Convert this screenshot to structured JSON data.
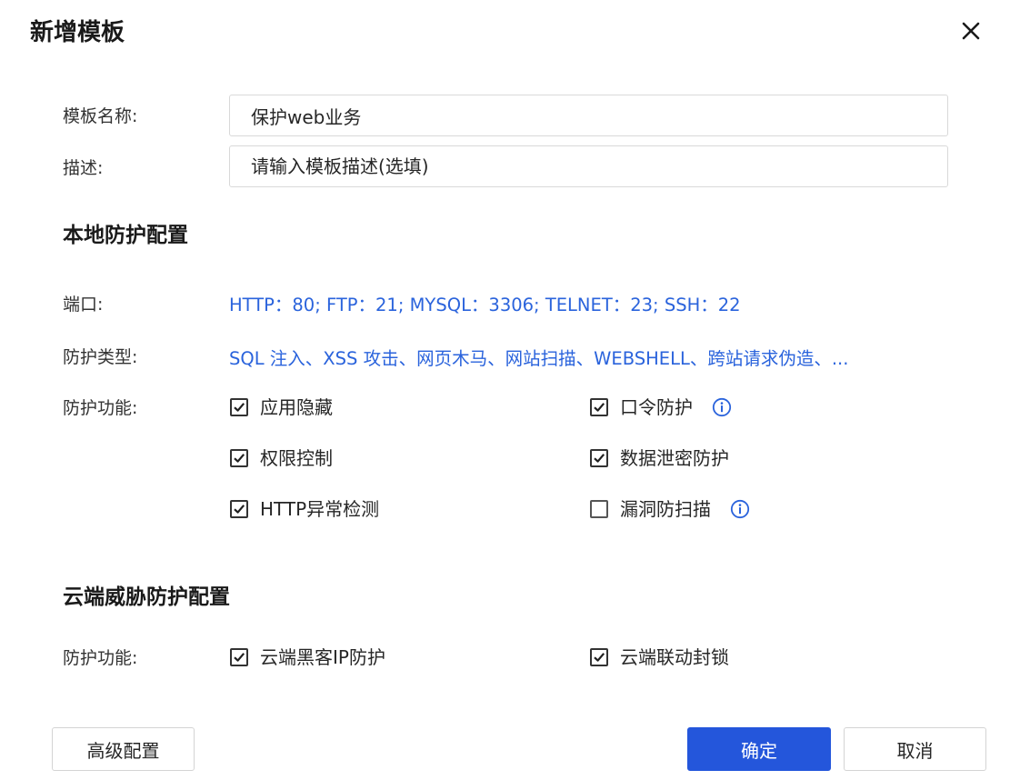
{
  "dialog": {
    "title": "新增模板",
    "close_icon": "close-icon"
  },
  "form": {
    "name_label": "模板名称:",
    "name_value": "保护web业务",
    "desc_label": "描述:",
    "desc_placeholder": "请输入模板描述(选填)"
  },
  "local": {
    "section_title": "本地防护配置",
    "ports_label": "端口:",
    "ports_value": "HTTP：80; FTP：21; MYSQL：3306; TELNET：23; SSH：22",
    "types_label": "防护类型:",
    "types_value": "SQL 注入、XSS 攻击、网页木马、网站扫描、WEBSHELL、跨站请求伪造、...",
    "functions_label": "防护功能:",
    "functions": [
      {
        "label": "应用隐藏",
        "checked": true
      },
      {
        "label": "口令防护",
        "checked": true,
        "info": true
      },
      {
        "label": "权限控制",
        "checked": true
      },
      {
        "label": "数据泄密防护",
        "checked": true
      },
      {
        "label": "HTTP异常检测",
        "checked": true
      },
      {
        "label": "漏洞防扫描",
        "checked": false,
        "info": true
      }
    ]
  },
  "cloud": {
    "section_title": "云端威胁防护配置",
    "functions_label": "防护功能:",
    "functions": [
      {
        "label": "云端黑客IP防护",
        "checked": true
      },
      {
        "label": "云端联动封锁",
        "checked": true
      }
    ]
  },
  "footer": {
    "advanced_label": "高级配置",
    "confirm_label": "确定",
    "cancel_label": "取消"
  },
  "colors": {
    "primary": "#2456db",
    "link": "#2a63dc",
    "info_icon": "#2a63dc"
  }
}
